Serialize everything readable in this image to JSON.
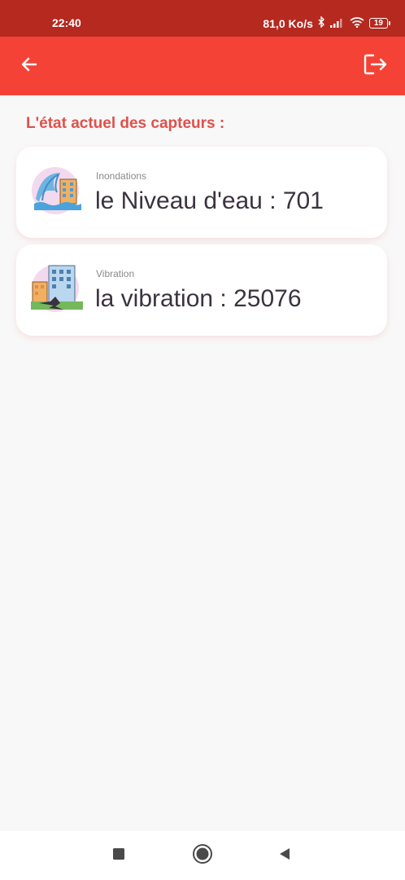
{
  "status_bar": {
    "time": "22:40",
    "net_speed": "81,0 Ko/s",
    "battery": "19",
    "icons": [
      "bluetooth-icon",
      "signal-icon",
      "wifi-icon",
      "battery-icon"
    ]
  },
  "app_bar": {
    "back_icon": "arrow-left-icon",
    "logout_icon": "logout-icon",
    "background": "#f44336"
  },
  "main": {
    "title": "L'état actuel des capteurs :",
    "cards": [
      {
        "label": "Inondations",
        "value_text": "le Niveau d'eau : 701",
        "icon": "flood-icon"
      },
      {
        "label": "Vibration",
        "value_text": "la vibration :  25076",
        "icon": "earthquake-icon"
      }
    ]
  },
  "nav_bar": {
    "icons": [
      "recent-apps-icon",
      "home-icon",
      "back-icon"
    ]
  },
  "colors": {
    "status_bar": "#b5291f",
    "accent": "#f44336",
    "title": "#e0504a",
    "value_text": "#3b3340"
  }
}
